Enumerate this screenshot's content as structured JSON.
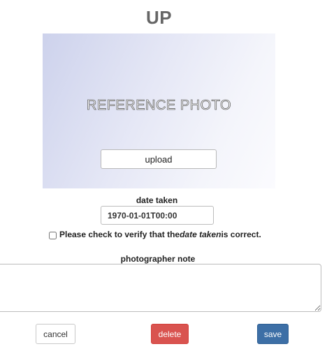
{
  "header": {
    "title": "UP"
  },
  "photo": {
    "placeholder_text": "REFERENCE PHOTO",
    "upload_label": "upload"
  },
  "date_taken": {
    "label": "date taken",
    "value": "1970-01-01T00:00"
  },
  "verify": {
    "text_before": "Please check to verify that the ",
    "text_italic": "date taken",
    "text_after": " is correct.",
    "checked": false
  },
  "note": {
    "label": "photographer note",
    "value": ""
  },
  "actions": {
    "cancel_label": "cancel",
    "delete_label": "delete",
    "save_label": "save"
  },
  "colors": {
    "delete": "#d9534f",
    "save": "#3d6fa6",
    "title": "#666666"
  }
}
